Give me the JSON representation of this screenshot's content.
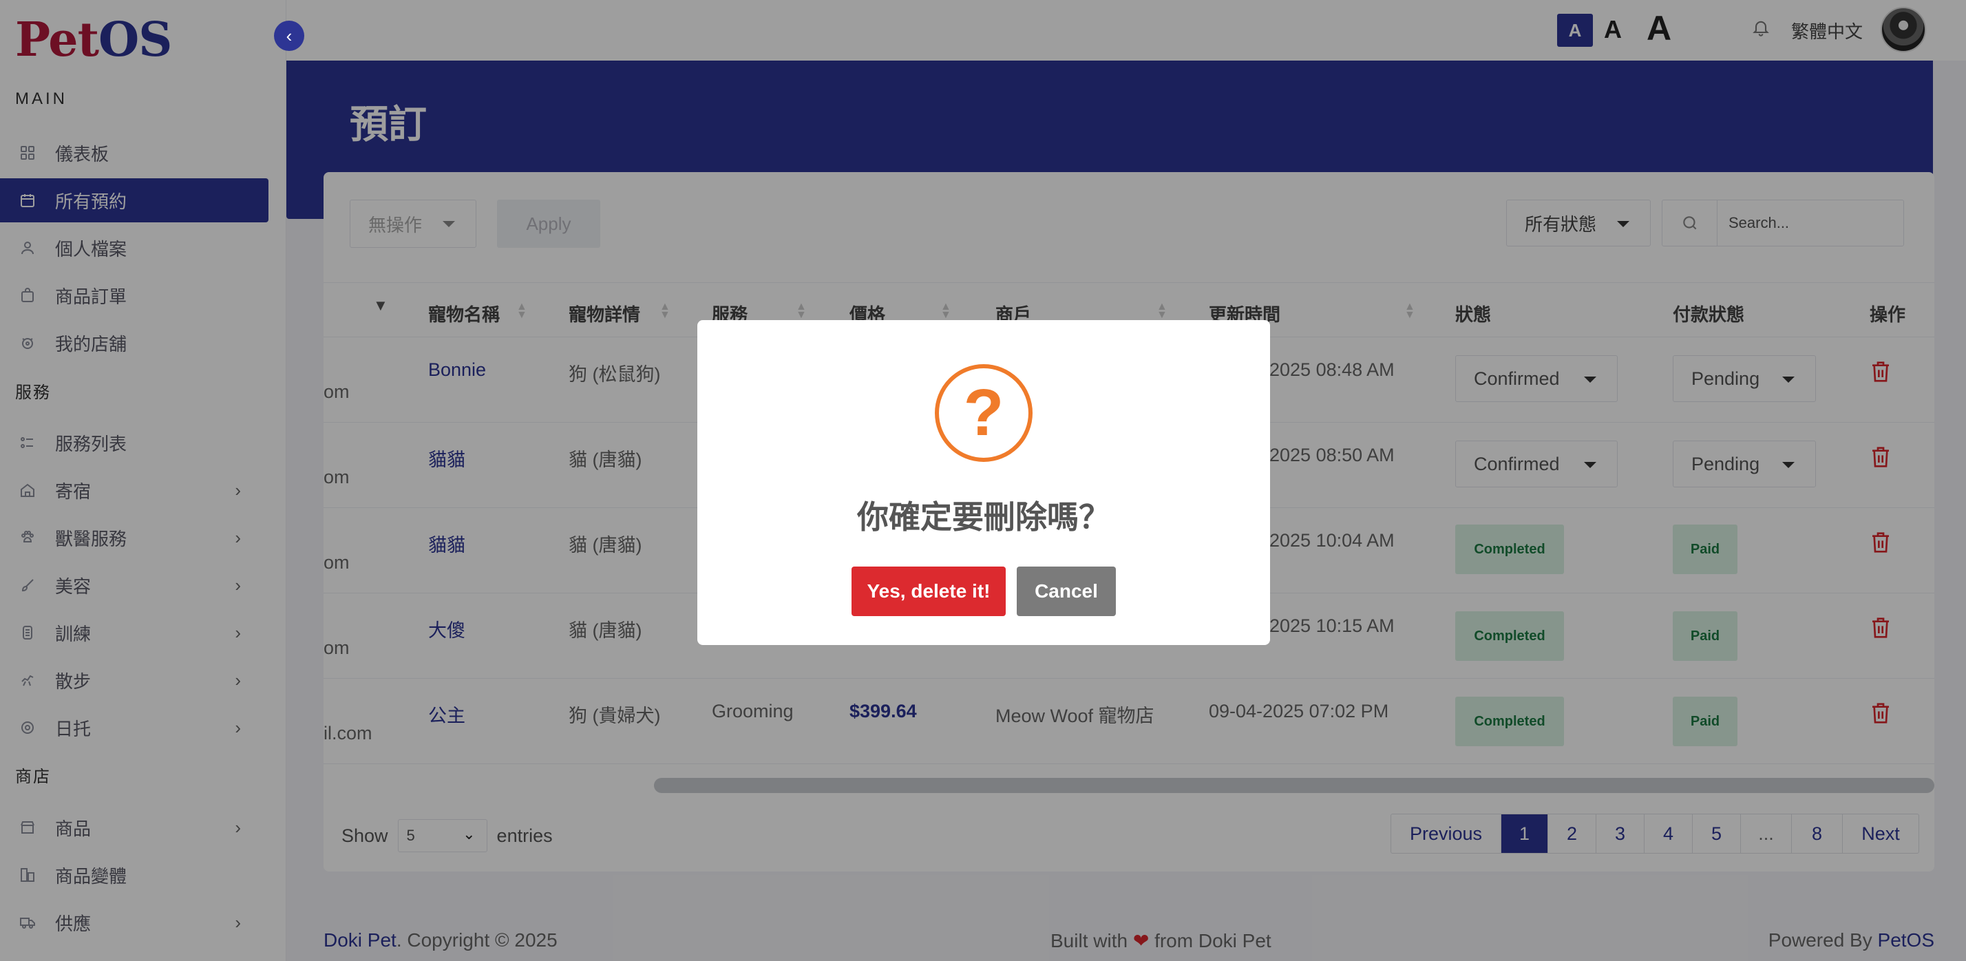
{
  "app": {
    "logo_pet": "Pet",
    "logo_os": "OS"
  },
  "sidebar": {
    "sections": [
      "MAIN",
      "服務",
      "商店"
    ],
    "items": [
      {
        "label": "儀表板",
        "icon": "grid-icon"
      },
      {
        "label": "所有預約",
        "icon": "calendar-icon",
        "active": true
      },
      {
        "label": "個人檔案",
        "icon": "user-icon"
      },
      {
        "label": "商品訂單",
        "icon": "bag-icon"
      },
      {
        "label": "我的店舖",
        "icon": "store-icon"
      },
      {
        "label": "服務列表",
        "icon": "list-icon"
      },
      {
        "label": "寄宿",
        "icon": "home-icon"
      },
      {
        "label": "獸醫服務",
        "icon": "paw-icon"
      },
      {
        "label": "美容",
        "icon": "brush-icon"
      },
      {
        "label": "訓練",
        "icon": "training-icon"
      },
      {
        "label": "散步",
        "icon": "walk-icon"
      },
      {
        "label": "日托",
        "icon": "daycare-icon"
      },
      {
        "label": "商品",
        "icon": "shop-icon"
      },
      {
        "label": "商品變體",
        "icon": "variant-icon"
      },
      {
        "label": "供應",
        "icon": "truck-icon"
      }
    ]
  },
  "topbar": {
    "font_small": "A",
    "font_medium": "A",
    "font_large": "A",
    "language": "繁體中文"
  },
  "page": {
    "title": "預訂"
  },
  "toolbar": {
    "bulk_action": "無操作",
    "apply": "Apply",
    "status_filter": "所有狀態",
    "search_placeholder": "Search..."
  },
  "table": {
    "headers": [
      "寵物名稱",
      "寵物詳情",
      "服務",
      "價格",
      "商戶",
      "更新時間",
      "狀態",
      "付款狀態",
      "操作"
    ],
    "rows": [
      {
        "email_tail": "om",
        "pet": "Bonnie",
        "details": "狗 (松鼠狗)",
        "service": "",
        "price": "",
        "merchant": "",
        "updated": "2025 08:48 AM",
        "status": "Confirmed",
        "payment": "Pending"
      },
      {
        "email_tail": "om",
        "pet": "貓貓",
        "details": "貓 (唐貓)",
        "service": "",
        "price": "",
        "merchant": "",
        "updated": "2025 08:50 AM",
        "status": "Confirmed",
        "payment": "Pending"
      },
      {
        "email_tail": "om",
        "pet": "貓貓",
        "details": "貓 (唐貓)",
        "service": "",
        "price": "",
        "merchant": "",
        "updated": "2025 10:04 AM",
        "status": "Completed",
        "payment": "Paid"
      },
      {
        "email_tail": "om",
        "pet": "大傻",
        "details": "貓 (唐貓)",
        "service": "",
        "price": "",
        "merchant": "",
        "updated": "2025 10:15 AM",
        "status": "Completed",
        "payment": "Paid"
      },
      {
        "email_tail": "il.com",
        "pet": "公主",
        "details": "狗 (貴婦犬)",
        "service": "Grooming",
        "price": "$399.64",
        "merchant": "Meow Woof 寵物店",
        "updated": "09-04-2025 07:02 PM",
        "status": "Completed",
        "payment": "Paid"
      }
    ]
  },
  "pagination": {
    "show": "Show",
    "entries_value": "5",
    "entries": "entries",
    "previous": "Previous",
    "pages": [
      "1",
      "2",
      "3",
      "4",
      "5",
      "...",
      "8"
    ],
    "next": "Next",
    "current": "1"
  },
  "footer": {
    "brand": "Doki Pet",
    "copyright": ". Copyright © 2025",
    "built_prefix": "Built with",
    "built_suffix": "from Doki Pet",
    "powered_prefix": "Powered By",
    "powered_brand": "PetOS"
  },
  "modal": {
    "icon_glyph": "?",
    "title": "你確定要刪除嗎？",
    "confirm": "Yes, delete it!",
    "cancel": "Cancel"
  },
  "colors": {
    "primary": "#2d3594",
    "danger": "#dc2a2f",
    "warning": "#f07b2a",
    "success_bg": "#d9f0e2",
    "success_text": "#1c7a43"
  }
}
